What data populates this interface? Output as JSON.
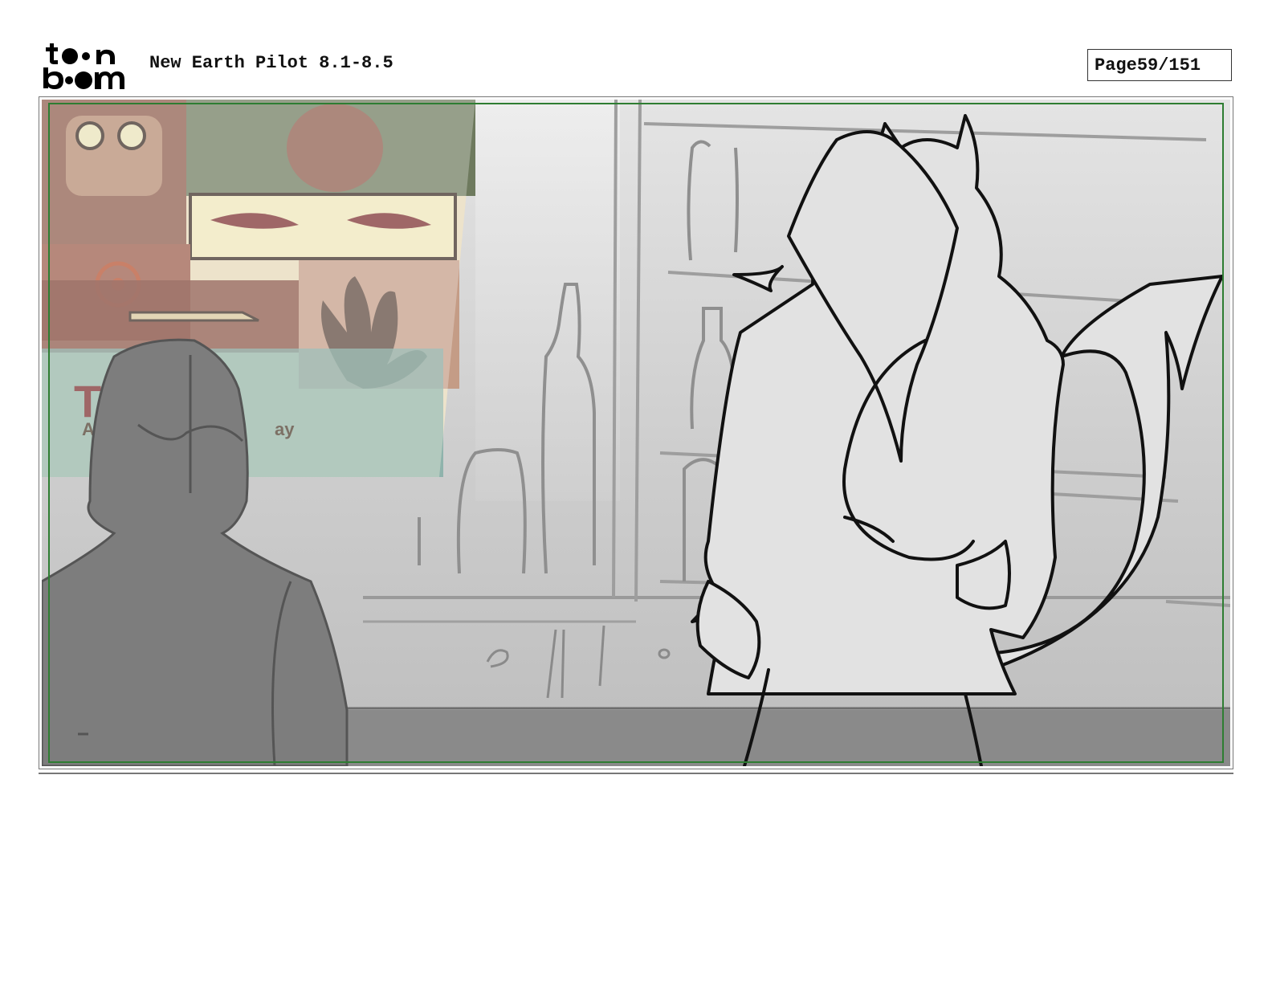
{
  "header": {
    "logo_alt": "toon boom",
    "title": "New Earth Pilot 8.1-8.5",
    "page_label": "Page",
    "page_number": "59/151"
  },
  "panel": {
    "poster_text_large": "T   LE",
    "poster_text_small_left": "A",
    "poster_text_small_right": "ay"
  }
}
